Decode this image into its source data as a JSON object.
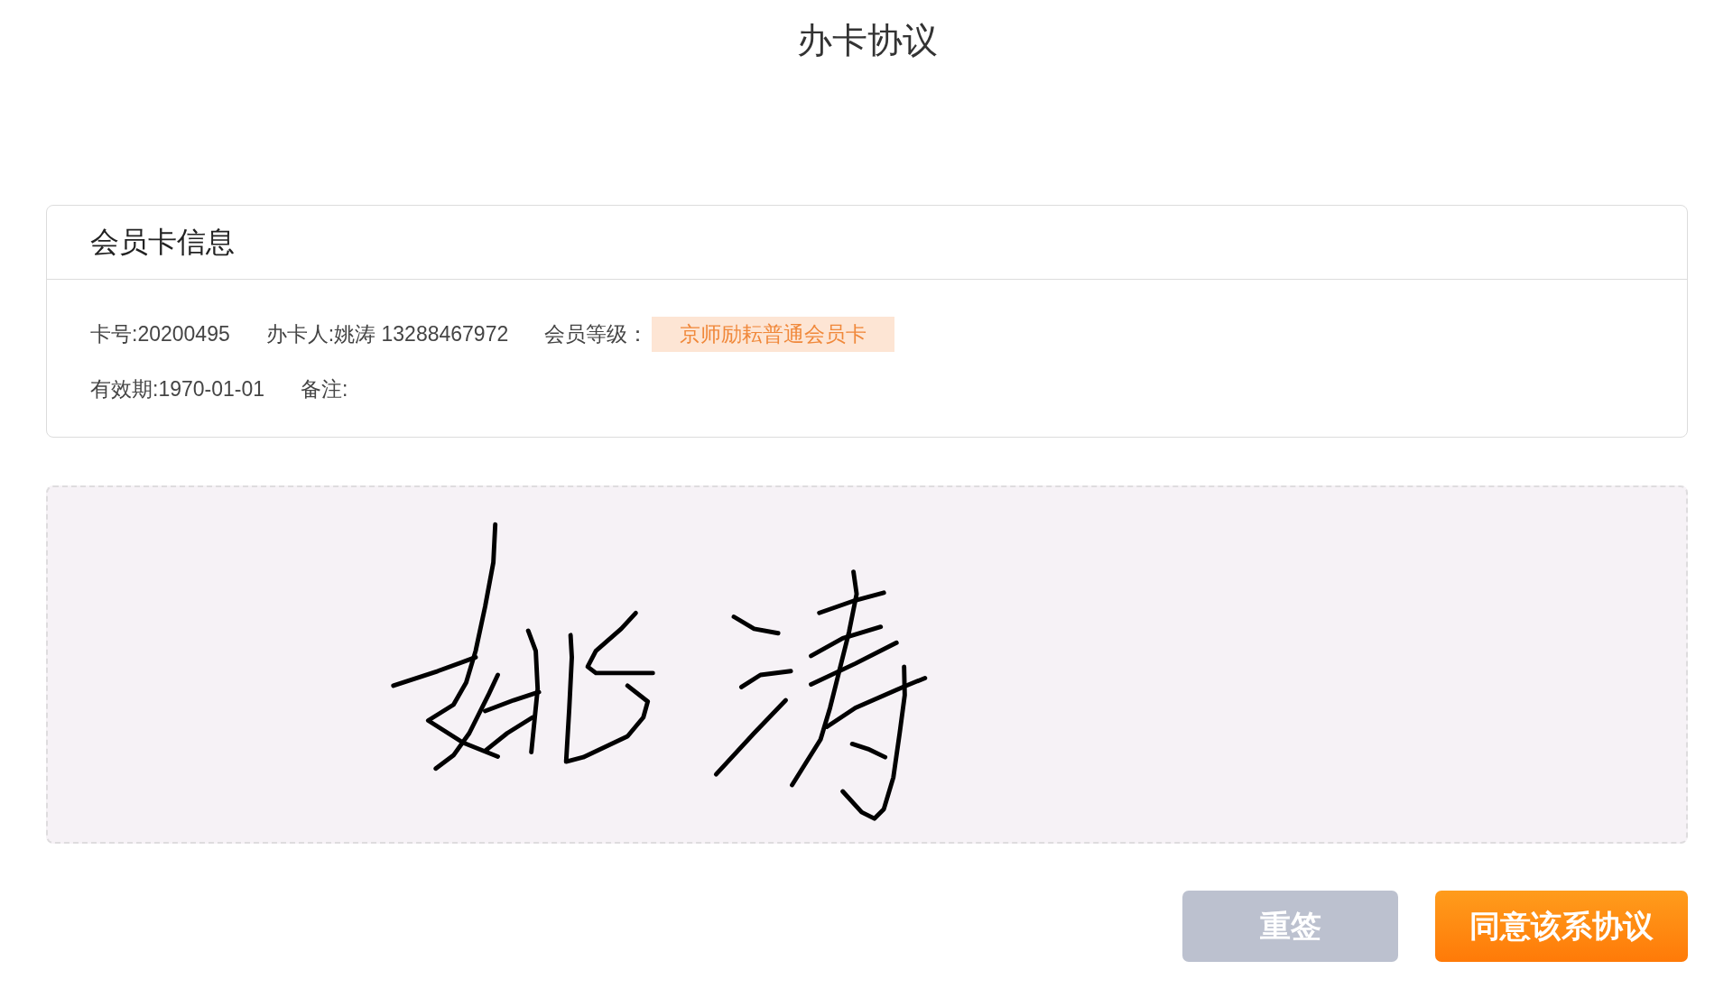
{
  "page": {
    "title": "办卡协议"
  },
  "card": {
    "heading": "会员卡信息",
    "rows": [
      [
        {
          "kind": "text",
          "text": "卡号:20200495"
        },
        {
          "kind": "text",
          "text": "办卡人:姚涛 13288467972"
        },
        {
          "kind": "tagged",
          "label": "会员等级：",
          "tag": "京师励耘普通会员卡"
        }
      ],
      [
        {
          "kind": "text",
          "text": "有效期:1970-01-01"
        },
        {
          "kind": "text",
          "text": "备注:"
        }
      ]
    ]
  },
  "signature_pad": {
    "signed": true
  },
  "buttons": [
    {
      "kind": "secondary",
      "label": "重签"
    },
    {
      "kind": "primary",
      "label": "同意该系协议"
    }
  ]
}
